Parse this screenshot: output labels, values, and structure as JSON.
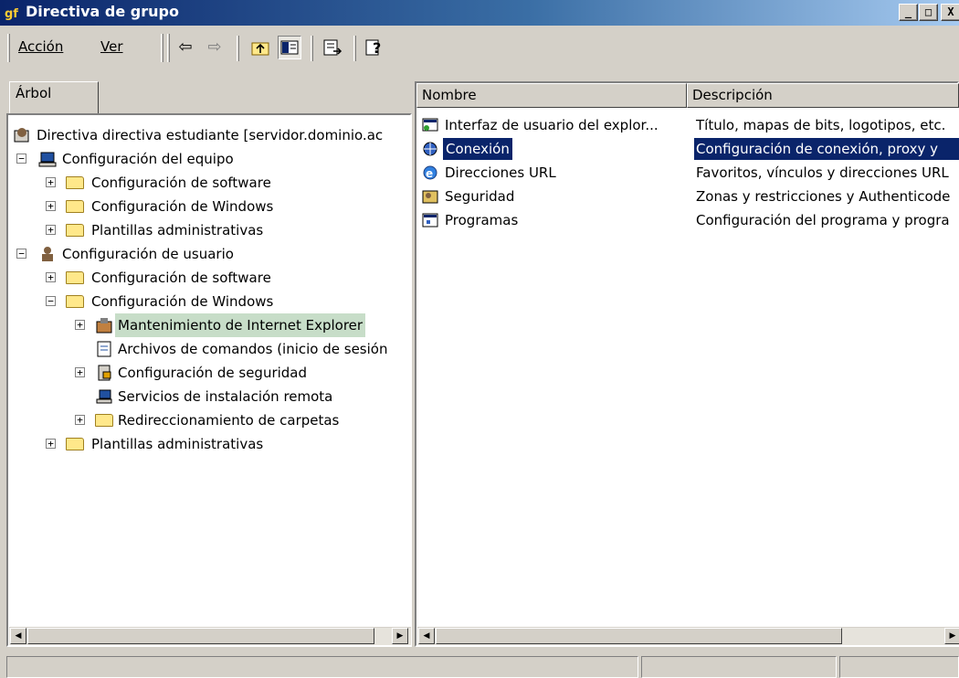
{
  "window": {
    "title": "Directiva de grupo",
    "buttons": {
      "minimize": "_",
      "maximize": "□",
      "close": "X"
    }
  },
  "menu": {
    "accion": "Acción",
    "ver": "Ver"
  },
  "toolbar_icons": [
    "back-arrow-icon",
    "forward-arrow-icon",
    "up-folder-icon",
    "show-hide-tree-icon",
    "export-list-icon",
    "help-icon"
  ],
  "tree": {
    "tab_label": "Árbol",
    "root": "Directiva directiva estudiante [servidor.dominio.ac",
    "computer": "Configuración del equipo",
    "computer_children": [
      "Configuración de software",
      "Configuración de Windows",
      "Plantillas administrativas"
    ],
    "user": "Configuración de usuario",
    "user_sw": "Configuración de software",
    "user_win": "Configuración de Windows",
    "user_win_children": [
      "Mantenimiento de Internet Explorer",
      "Archivos de comandos (inicio de sesión",
      "Configuración de seguridad",
      "Servicios de instalación remota",
      "Redireccionamiento de carpetas"
    ],
    "user_admin": "Plantillas administrativas"
  },
  "list": {
    "columns": {
      "name": "Nombre",
      "description": "Descripción"
    },
    "rows": [
      {
        "name": "Interfaz de usuario del explor...",
        "description": "Título, mapas de bits, logotipos, etc."
      },
      {
        "name": "Conexión",
        "description": "Configuración de conexión, proxy y"
      },
      {
        "name": "Direcciones URL",
        "description": "Favoritos, vínculos y direcciones URL"
      },
      {
        "name": "Seguridad",
        "description": "Zonas y restricciones y Authenticode"
      },
      {
        "name": "Programas",
        "description": "Configuración del programa y progra"
      }
    ],
    "selected_row": "Conexión"
  },
  "colors": {
    "selection": "#0a246a",
    "title_gradient_start": "#0a246a",
    "tree_highlight": "#c7ddc8"
  }
}
